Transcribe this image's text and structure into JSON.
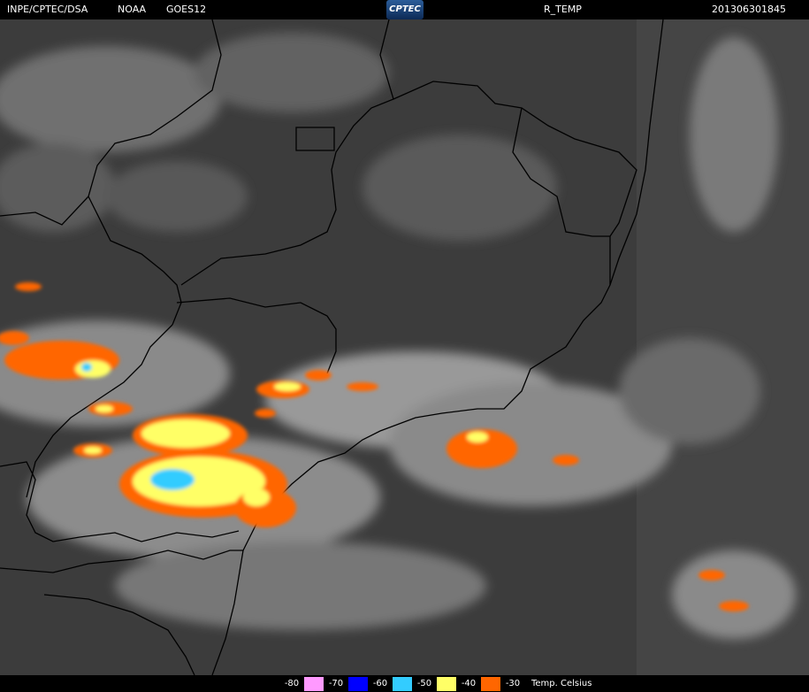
{
  "header": {
    "agency": "INPE/CPTEC/DSA",
    "source": "NOAA",
    "satellite": "GOES12",
    "logo_text": "CPTEC",
    "product": "R_TEMP",
    "timestamp": "201306301845"
  },
  "legend": {
    "items": [
      {
        "label": "-80",
        "color": "#ff99ff"
      },
      {
        "label": "-70",
        "color": "#0000ff"
      },
      {
        "label": "-60",
        "color": "#33ccff"
      },
      {
        "label": "-50",
        "color": "#ffff66"
      },
      {
        "label": "-40",
        "color": "#ff6600"
      },
      {
        "label": "-30",
        "color": null
      }
    ],
    "units": "Temp. Celsius"
  },
  "colors": {
    "background": "#3a3a3a",
    "clouds": "#9a9a9a",
    "borders": "#000000",
    "cold_orange": "#ff6600",
    "cold_yellow": "#ffff66",
    "cold_cyan": "#33ccff"
  }
}
